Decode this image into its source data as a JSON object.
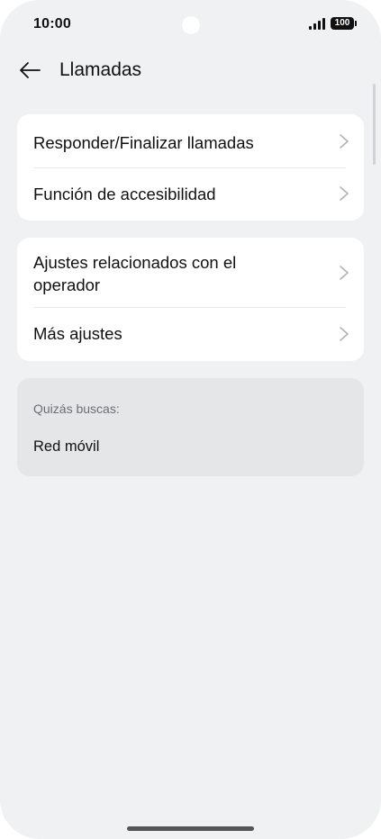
{
  "status_bar": {
    "time": "10:00",
    "battery": "100",
    "icons": [
      "camera-cutout",
      "signal-icon",
      "battery-icon"
    ]
  },
  "header": {
    "title": "Llamadas",
    "back_icon": "arrow-left-icon"
  },
  "groups": [
    {
      "items": [
        {
          "label": "Responder/Finalizar llamadas",
          "icon": "chevron-right-icon"
        },
        {
          "label": "Función de accesibilidad",
          "icon": "chevron-right-icon"
        }
      ]
    },
    {
      "items": [
        {
          "label": "Ajustes relacionados con el operador",
          "icon": "chevron-right-icon"
        },
        {
          "label": "Más ajustes",
          "icon": "chevron-right-icon"
        }
      ]
    }
  ],
  "suggestions": {
    "title": "Quizás buscas:",
    "items": [
      "Red móvil"
    ]
  },
  "colors": {
    "background": "#f0f1f3",
    "card": "#ffffff",
    "suggestion_card": "#e5e6e8",
    "text_primary": "#111111",
    "text_secondary": "#6d6e72",
    "chevron": "#b3b4b8"
  }
}
